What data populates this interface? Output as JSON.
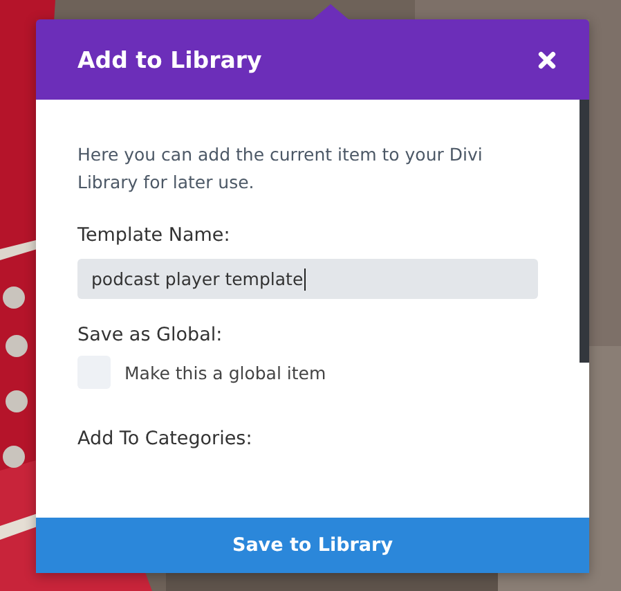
{
  "dialog": {
    "title": "Add to Library",
    "description": "Here you can add the current item to your Divi Library for later use.",
    "fields": [
      {
        "kind": "text",
        "label": "Template Name:",
        "value": "podcast player template"
      },
      {
        "kind": "checkbox",
        "label": "Save as Global:",
        "option": "Make this a global item",
        "checked": false
      },
      {
        "kind": "heading",
        "label": "Add To Categories:"
      }
    ],
    "button": "Save to Library"
  }
}
